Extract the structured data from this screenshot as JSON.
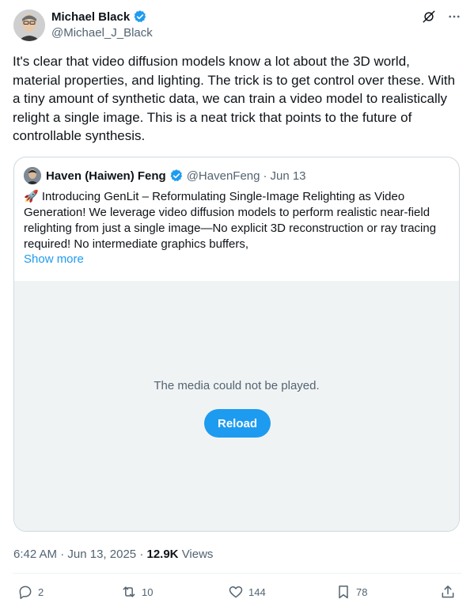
{
  "author": {
    "name": "Michael Black",
    "handle": "@Michael_J_Black",
    "verified": true,
    "avatar_icon": "portrait-avatar"
  },
  "tweet": {
    "text": "It's clear that video diffusion models know a lot about the 3D world, material properties, and lighting. The trick is to get control over these. With a tiny amount of synthetic data, we can train a video model to realistically relight a single image. This is a neat trick that points to the future of controllable synthesis."
  },
  "quote": {
    "name": "Haven (Haiwen) Feng",
    "handle": "@HavenFeng",
    "separator": "·",
    "date": "Jun 13",
    "text": "🚀 Introducing GenLit – Reformulating Single-Image Relighting as Video Generation! We leverage video diffusion models to perform realistic near-field relighting from just a single image—No explicit 3D reconstruction or ray tracing required! No intermediate graphics buffers,",
    "show_more": "Show more",
    "media_message": "The media could not be played.",
    "reload_label": "Reload"
  },
  "meta": {
    "time": "6:42 AM",
    "dot1": "·",
    "date": "Jun 13, 2025",
    "dot2": "·",
    "views_count": "12.9K",
    "views_label": "Views"
  },
  "actions": {
    "replies": "2",
    "reposts": "10",
    "likes": "144",
    "bookmarks": "78"
  },
  "colors": {
    "accent": "#1d9bf0",
    "text": "#0f1419",
    "secondary": "#536471",
    "border": "#cfd9de",
    "media_bg": "#f0f3f4"
  }
}
